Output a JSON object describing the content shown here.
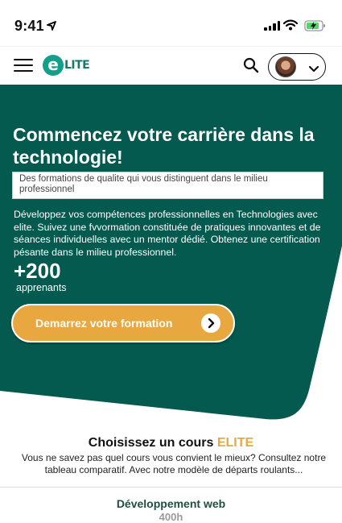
{
  "status_bar": {
    "time": "9:41"
  },
  "hero": {
    "title": "Commencez votre carrière dans la technologie!",
    "subtitle": "Des formations de qualite qui vous distinguent dans le milieu professionnel",
    "description": "Développez vos compétences professionnelles en Technologies avec elite. Suivez une fvvormation constituée de pratiques innovantes et de séances individuelles avec un mentor dédié. Obtenez une certification pésante dans le milieu professionnel.",
    "stat_value": "+200",
    "stat_label": "apprenants",
    "cta_label": "Demarrez votre formation"
  },
  "courses_section": {
    "title": "Choisissez un cours",
    "title_accent": "ELITE",
    "description": "Vous ne savez pas quel cours vous convient le mieux? Consultez notre tableau comparatif. Avec notre modèle de départs roulants..."
  },
  "course_card": {
    "title": "Développement web",
    "duration": "400h"
  },
  "logo": {
    "letter": "e",
    "text": "lite"
  },
  "colors": {
    "primary": "#045a4f",
    "accent": "#e9a73f",
    "logo": "#12a08a"
  },
  "icons": [
    "location-arrow-icon",
    "signal-icon",
    "wifi-icon",
    "battery-icon",
    "hamburger-menu-icon",
    "search-icon",
    "chevron-down-icon",
    "arrow-right-icon"
  ]
}
